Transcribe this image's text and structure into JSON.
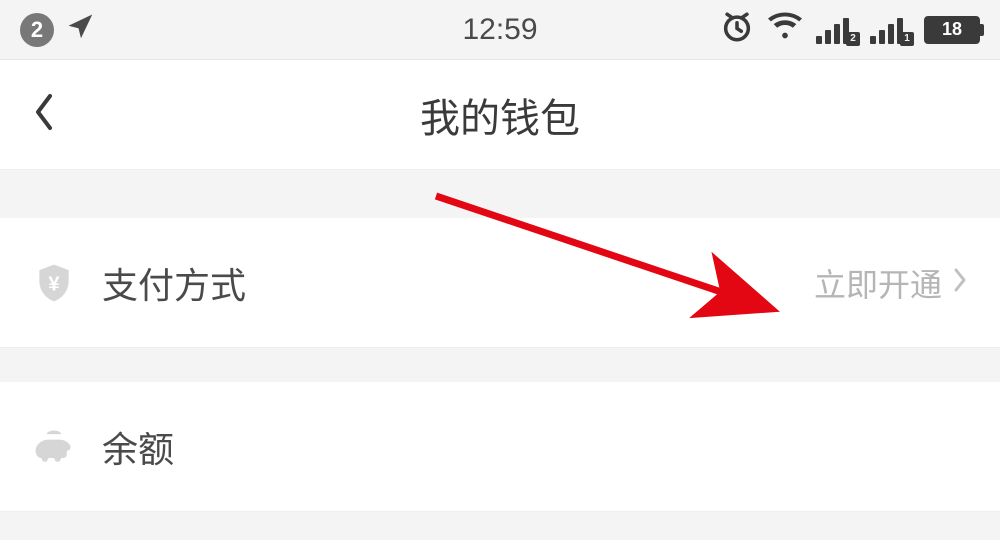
{
  "statusbar": {
    "notification_count": "2",
    "time": "12:59",
    "battery_level": "18",
    "sim1_label": "2",
    "sim2_label": "1"
  },
  "navbar": {
    "title": "我的钱包"
  },
  "list": {
    "payment_method": {
      "label": "支付方式",
      "action_text": "立即开通"
    },
    "balance": {
      "label": "余额"
    }
  }
}
